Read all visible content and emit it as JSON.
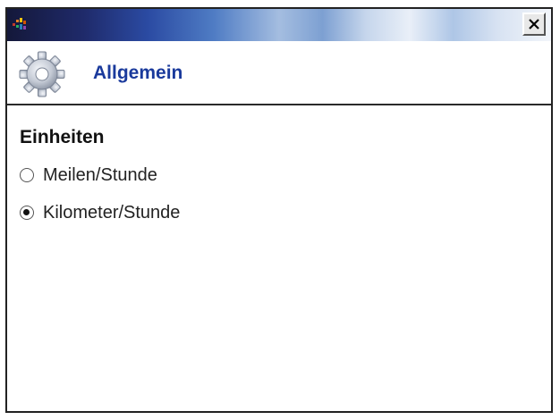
{
  "window": {
    "close_symbol": "✕"
  },
  "header": {
    "title": "Allgemein",
    "icon": "gear-icon"
  },
  "section": {
    "label": "Einheiten"
  },
  "options": [
    {
      "label": "Meilen/Stunde",
      "selected": false
    },
    {
      "label": "Kilometer/Stunde",
      "selected": true
    }
  ],
  "colors": {
    "title_accent": "#1a3a9c"
  }
}
